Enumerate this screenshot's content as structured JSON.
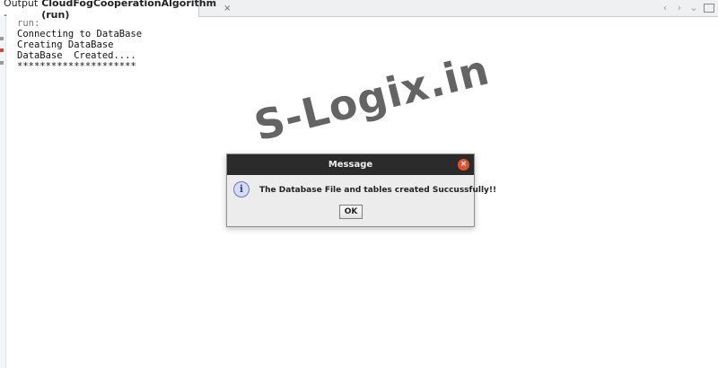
{
  "tab": {
    "prefix": "Output -",
    "title": "CloudFogCooperationAlgorithm (run)",
    "close_glyph": "×"
  },
  "tabnav": {
    "prev_glyph": "‹",
    "next_glyph": "›",
    "menu_glyph": "⌄"
  },
  "console": {
    "lines": [
      "run:",
      "Connecting to DataBase",
      "Creating DataBase",
      "DataBase  Created....",
      "*********************"
    ]
  },
  "watermark": {
    "text": "S-Logix.in"
  },
  "dialog": {
    "title": "Message",
    "close_glyph": "×",
    "icon_glyph": "i",
    "message": "The  Database File and tables created Succussfully!!",
    "ok_label": "OK"
  },
  "colors": {
    "dialog_titlebar": "#2b2b2b",
    "dialog_close": "#e0522f",
    "info_icon": "#3a44a8"
  }
}
